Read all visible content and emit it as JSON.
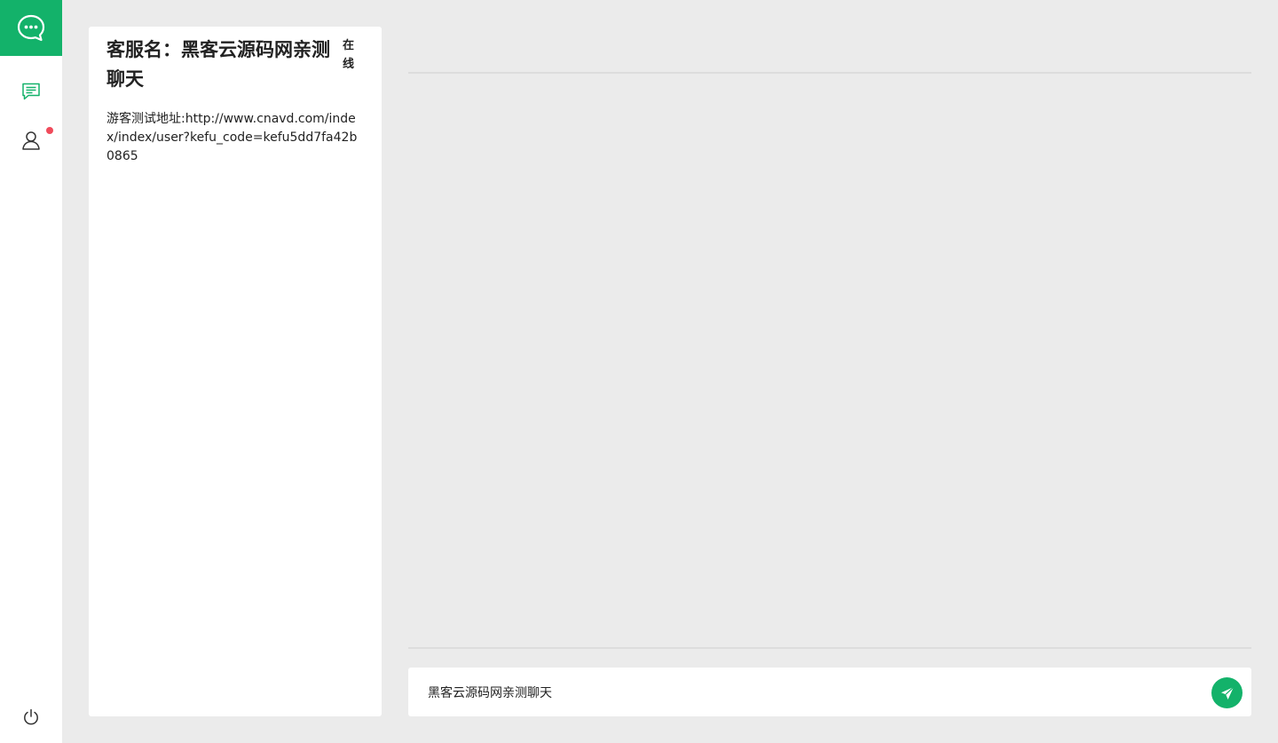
{
  "nav": {
    "logo_icon": "chat-bubble-icon",
    "items": [
      {
        "icon": "message-icon",
        "active": true
      },
      {
        "icon": "user-icon",
        "has_badge": true
      }
    ],
    "bottom_icon": "power-icon",
    "accent_color": "#13b26a",
    "badge_color": "#f04b5b"
  },
  "info": {
    "title": "客服名：黑客云源码网亲测聊天",
    "status": "在线",
    "description": "游客测试地址:http://www.cnavd.com/index/index/user?kefu_code=kefu5dd7fa42b0865"
  },
  "composer": {
    "value": "黑客云源码网亲测聊天",
    "send_icon": "paper-plane-icon"
  }
}
